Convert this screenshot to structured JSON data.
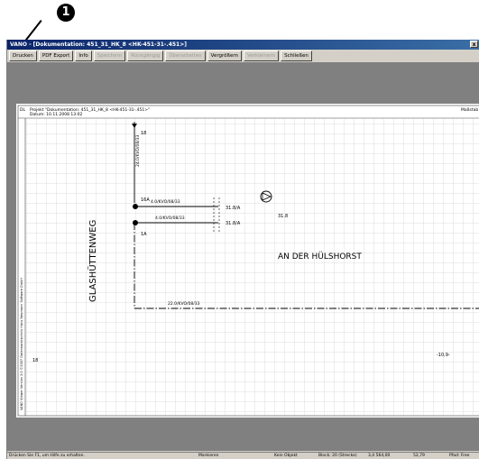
{
  "callout": {
    "number": "1"
  },
  "window": {
    "title": "VANO - [Dokumentation: 451_31_HK_8 <HK-451-31-.451>]",
    "close_label": "x"
  },
  "toolbar": {
    "items": [
      {
        "label": "Drucken",
        "enabled": true
      },
      {
        "label": "PDF Export",
        "enabled": true
      },
      {
        "label": "Info",
        "enabled": true
      },
      {
        "label": "Speichern",
        "enabled": false
      },
      {
        "label": "Rückgängig",
        "enabled": false
      },
      {
        "label": "Überarbeiten",
        "enabled": false
      },
      {
        "label": "Vergrößern",
        "enabled": true
      },
      {
        "label": "Verkleinern",
        "enabled": false
      },
      {
        "label": "Schließen",
        "enabled": true
      }
    ]
  },
  "document": {
    "header_code": "DL",
    "header_line1": "Projekt \"Dokumentation: 451_31_HK_8 <HK-451-31-.451>\"",
    "header_line2": "Datum: 10.11.2008 13:02",
    "scale_label": "Maßstab",
    "side_text": "VANO Viewer Version 3.0 ©2007 Datenbanktechnik Hans Neumann Software GmbH",
    "street_vertical": "GLASHÜTTENWEG",
    "street_horizontal": "AN DER HÜLSHORST",
    "labels": {
      "l18_top": "18",
      "l16a": "16A",
      "cable1": "4.0/KVO/08/33",
      "cable2": "4.0/KVO/08/33",
      "v318a_1": "31.8/A",
      "v318a_2": "31.8/A",
      "v318": "31.8",
      "l1a": "1A",
      "cable3": "22.0/KVO/08/33",
      "l18_bottom": "18",
      "l109": "-10,9-",
      "vertical_cable": "24.0/KVO/08/33"
    }
  },
  "status": {
    "hint": "Drücken Sie F1, um Hilfe zu erhalten.",
    "mode": "Markieren",
    "object": "Kein Objekt",
    "block": "Block: 20 (Strecke)",
    "coord1": "3,4 564,00",
    "coord2": "52,79",
    "page": "Pfad: Free"
  }
}
